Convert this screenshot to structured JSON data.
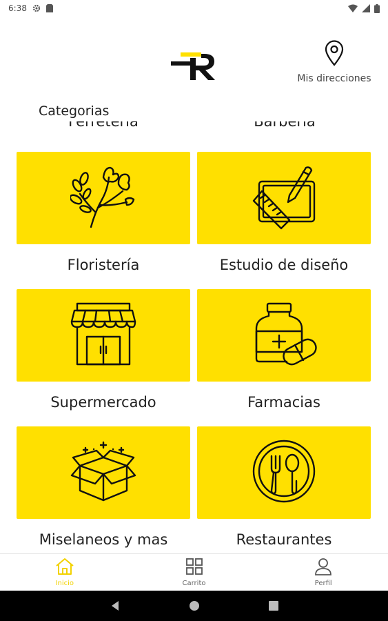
{
  "status_bar": {
    "time": "6:38",
    "icons": [
      "settings-icon",
      "sim-icon",
      "wifi-icon",
      "signal-icon",
      "battery-icon"
    ]
  },
  "header": {
    "logo_icon": "brand-r-logo",
    "location_label": "Mis direcciones",
    "location_icon": "map-pin-icon"
  },
  "section_title": "Categorias",
  "partial_categories": [
    "Ferretería",
    "Barbería"
  ],
  "categories": [
    {
      "label": "Floristería",
      "icon": "flowers-icon"
    },
    {
      "label": "Estudio de diseño",
      "icon": "design-tablet-icon"
    },
    {
      "label": "Supermercado",
      "icon": "storefront-icon"
    },
    {
      "label": "Farmacias",
      "icon": "medicine-icon"
    },
    {
      "label": "Miselaneos y mas",
      "icon": "box-icon"
    },
    {
      "label": "Restaurantes",
      "icon": "plate-utensils-icon"
    }
  ],
  "bottom_nav": {
    "items": [
      {
        "label": "Inicio",
        "icon": "home-icon",
        "active": true
      },
      {
        "label": "Carrito",
        "icon": "grid-icon",
        "active": false
      },
      {
        "label": "Perfil",
        "icon": "person-icon",
        "active": false
      }
    ]
  },
  "colors": {
    "accent": "#ffe000",
    "active_nav": "#f2d200",
    "text": "#222222",
    "system_nav": "#000000"
  }
}
